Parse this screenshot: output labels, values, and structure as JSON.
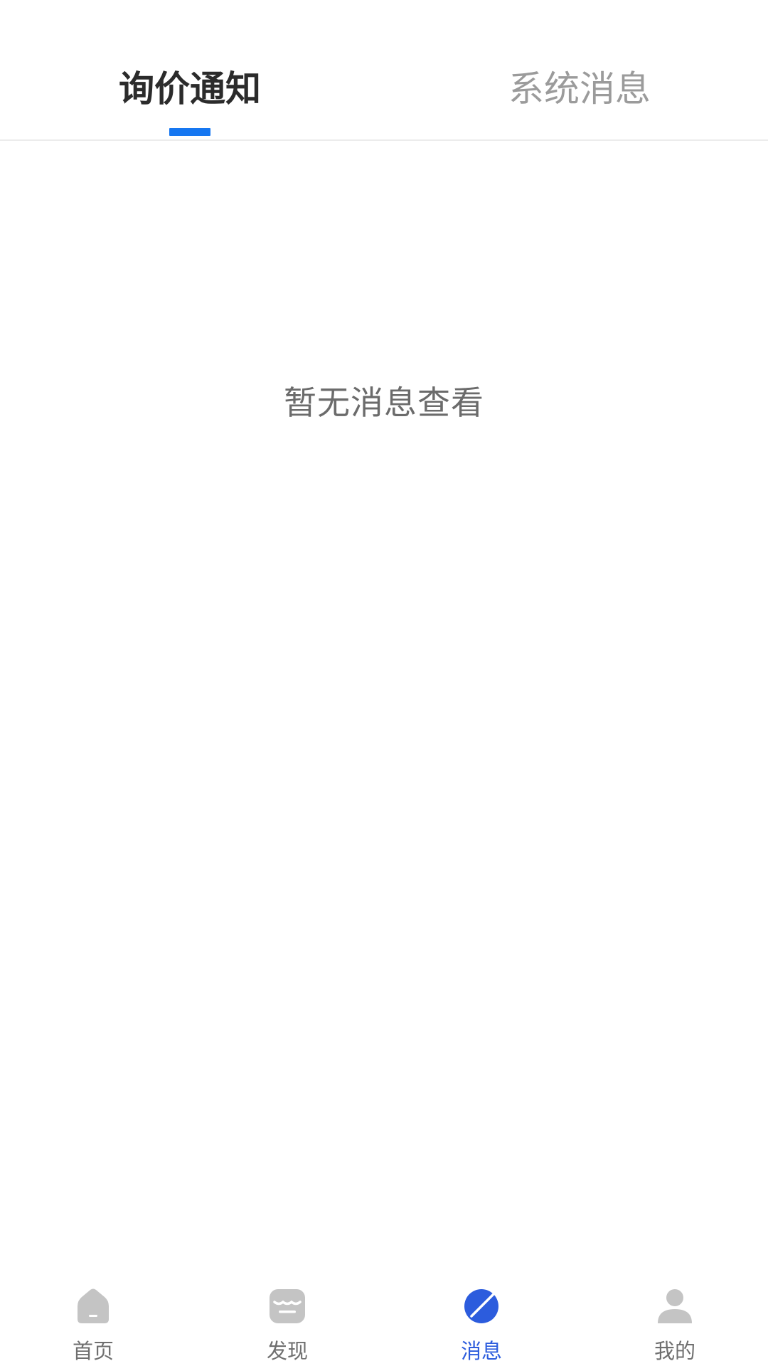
{
  "tabs": {
    "active_label": "询价通知",
    "inactive_label": "系统消息"
  },
  "empty_state": {
    "message": "暂无消息查看"
  },
  "bottom_nav": {
    "items": [
      {
        "label": "首页",
        "icon": "home-icon",
        "active": false
      },
      {
        "label": "发现",
        "icon": "store-icon",
        "active": false
      },
      {
        "label": "消息",
        "icon": "planet-icon",
        "active": true
      },
      {
        "label": "我的",
        "icon": "person-icon",
        "active": false
      }
    ]
  },
  "colors": {
    "accent": "#1677f1",
    "nav_active": "#2c5cdd",
    "nav_inactive_icon": "#c4c4c4",
    "text_primary": "#2b2b2b",
    "text_secondary": "#9b9b9b"
  }
}
